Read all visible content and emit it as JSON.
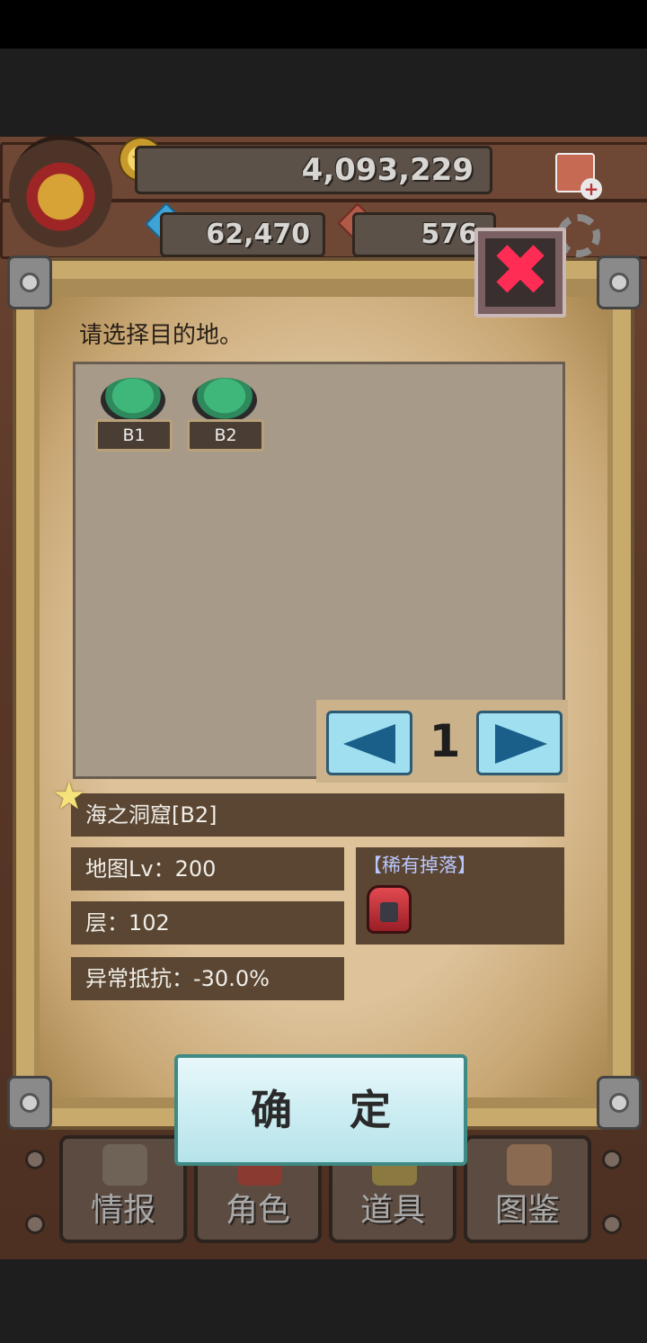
{
  "hud": {
    "gold": "4,093,229",
    "blue_gems": "62,470",
    "red_gems": "576"
  },
  "dialog": {
    "title": "请选择目的地。",
    "maps": [
      "B1",
      "B2"
    ],
    "page": "1",
    "selected_map": "海之洞窟[B2]",
    "map_level": "地图Lv：200",
    "floor": "层：102",
    "status_resist": "异常抵抗：-30.0%",
    "rare_drop_label": "【稀有掉落】",
    "confirm_label": "确 定",
    "close_symbol": "✖"
  },
  "tabs": [
    {
      "label": "情报"
    },
    {
      "label": "角色"
    },
    {
      "label": "道具"
    },
    {
      "label": "图鉴"
    }
  ],
  "colors": {
    "close_x": "#ff2d55",
    "arrow": "#1a5e8a",
    "info_box": "#5a4632"
  }
}
